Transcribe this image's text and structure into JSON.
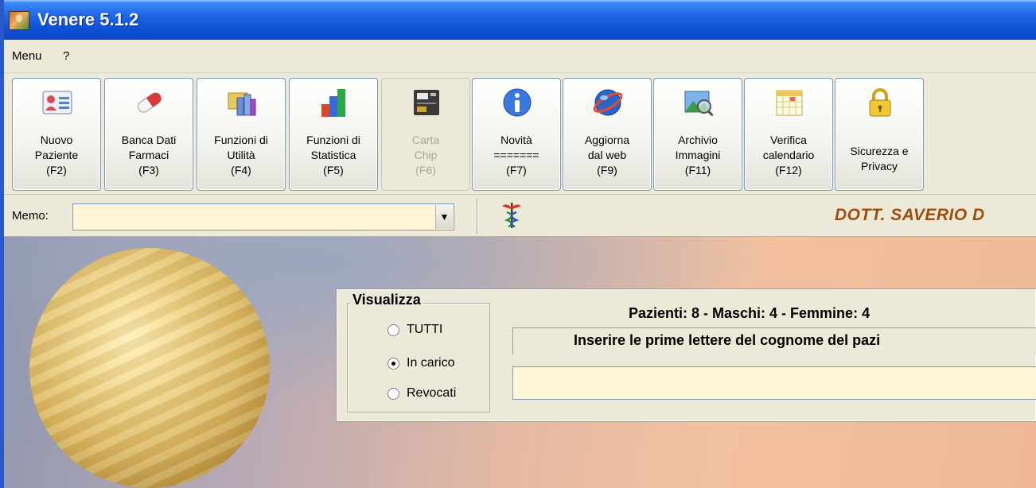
{
  "window": {
    "title": "Venere 5.1.2"
  },
  "menu": {
    "items": [
      "Menu",
      "?"
    ]
  },
  "toolbar": {
    "buttons": [
      {
        "label": "Nuovo\nPaziente\n(F2)",
        "icon": "id-card-icon",
        "enabled": true
      },
      {
        "label": "Banca Dati\nFarmaci\n(F3)",
        "icon": "pill-capsule-icon",
        "enabled": true
      },
      {
        "label": "Funzioni di\nUtilità\n(F4)",
        "icon": "utility-folder-icon",
        "enabled": true
      },
      {
        "label": "Funzioni di\nStatistica\n(F5)",
        "icon": "bar-chart-icon",
        "enabled": true
      },
      {
        "label": "Carta\nChip\n(F6)",
        "icon": "chip-card-reader-icon",
        "enabled": false
      },
      {
        "label": "Novità\n=======\n(F7)",
        "icon": "info-icon",
        "enabled": true
      },
      {
        "label": "Aggiorna\ndal web\n(F9)",
        "icon": "web-globe-icon",
        "enabled": true
      },
      {
        "label": "Archivio\nImmagini\n(F11)",
        "icon": "image-magnifier-icon",
        "enabled": true
      },
      {
        "label": "Verifica\ncalendario\n(F12)",
        "icon": "calendar-icon",
        "enabled": true
      },
      {
        "label": "Sicurezza e\nPrivacy",
        "icon": "padlock-icon",
        "enabled": true
      }
    ]
  },
  "memo": {
    "label": "Memo:",
    "value": ""
  },
  "header": {
    "doctor": "DOTT. SAVERIO D"
  },
  "panel": {
    "group_title": "Visualizza",
    "options": [
      {
        "label": "TUTTI",
        "checked": false
      },
      {
        "label": "In carico",
        "checked": true
      },
      {
        "label": "Revocati",
        "checked": false
      }
    ],
    "stats": "Pazienti: 8   -   Maschi: 4   -   Femmine: 4",
    "hint": "Inserire le prime lettere del cognome del pazi",
    "search_value": ""
  },
  "colors": {
    "titlebar": "#0a48c6",
    "input_bg": "#fff5d6",
    "doctor_name": "#9b4d0e"
  }
}
